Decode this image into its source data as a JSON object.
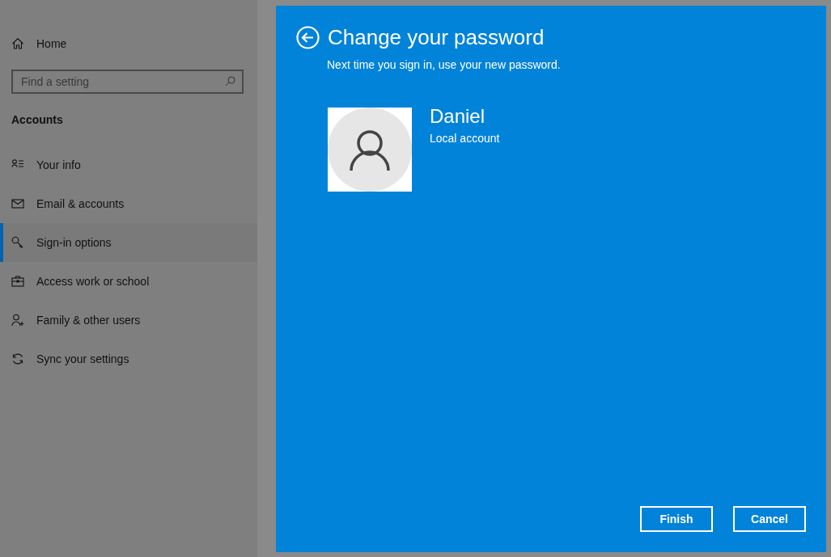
{
  "sidebar": {
    "home": "Home",
    "search": {
      "placeholder": "Find a setting"
    },
    "section": "Accounts",
    "items": [
      {
        "label": "Your info",
        "selected": false
      },
      {
        "label": "Email & accounts",
        "selected": false
      },
      {
        "label": "Sign-in options",
        "selected": true
      },
      {
        "label": "Access work or school",
        "selected": false
      },
      {
        "label": "Family & other users",
        "selected": false
      },
      {
        "label": "Sync your settings",
        "selected": false
      }
    ]
  },
  "dialog": {
    "title": "Change your password",
    "subtitle": "Next time you sign in, use your new password.",
    "user": {
      "name": "Daniel",
      "account_type": "Local account"
    },
    "buttons": [
      "Finish",
      "Cancel"
    ]
  }
}
